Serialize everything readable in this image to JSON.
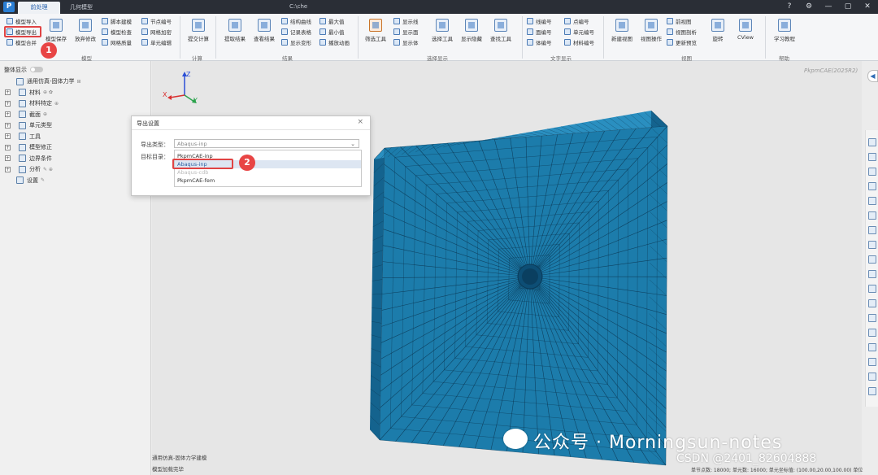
{
  "titlebar": {
    "tabs": [
      "前处理",
      "几何模型"
    ],
    "window_title": "C:\\che",
    "icons": [
      "help-icon",
      "settings-icon",
      "minimize-icon",
      "maximize-icon",
      "close-icon"
    ]
  },
  "ribbon": {
    "model_small": [
      "模型导入",
      "模型导出",
      "模型合并"
    ],
    "model_large": [
      "模型保存",
      "放弃修改"
    ],
    "model_col3": [
      "脚本建模",
      "模型检查",
      "网格质量"
    ],
    "model_col4": [
      "节点编号",
      "网格加密",
      "单元编辑"
    ],
    "calc_button": "提交计算",
    "result_buttons": [
      "提取结果",
      "查看结果"
    ],
    "result_small": [
      "结构曲线",
      "记录表格",
      "显示变形"
    ],
    "result_small2": [
      "最大值",
      "最小值",
      "播放动画"
    ],
    "select_large": "筛选工具",
    "select_small": [
      "显示线",
      "显示面",
      "显示体"
    ],
    "select_buttons": [
      "选择工具",
      "显示隐藏",
      "查找工具"
    ],
    "text_small1": [
      "线编号",
      "面编号",
      "体编号"
    ],
    "text_small2": [
      "点编号",
      "单元编号",
      "材料编号"
    ],
    "view_buttons": [
      "新建视图",
      "视图操作"
    ],
    "view_small": [
      "前视图",
      "视图剖析",
      "更新预览"
    ],
    "view_buttons2": [
      "旋转",
      "CView"
    ],
    "help_button": "学习教程",
    "groups": [
      "模型",
      "计算",
      "结果",
      "选择显示",
      "文字显示",
      "视图",
      "帮助"
    ]
  },
  "left_panel": {
    "title": "整体显示",
    "tree": [
      {
        "label": "通用仿真-固体力学",
        "sub": "⊞",
        "expand": false
      },
      {
        "label": "材料",
        "sub": "⊕ ✿",
        "expand": true
      },
      {
        "label": "材料特定",
        "sub": "⊕",
        "expand": true
      },
      {
        "label": "截面",
        "sub": "⊕",
        "expand": true
      },
      {
        "label": "单元类型",
        "sub": "",
        "expand": true
      },
      {
        "label": "工具",
        "sub": "",
        "expand": true
      },
      {
        "label": "模型修正",
        "sub": "",
        "expand": true
      },
      {
        "label": "边界条件",
        "sub": "",
        "expand": true
      },
      {
        "label": "分析",
        "sub": "✎ ⊕",
        "expand": true
      },
      {
        "label": "设置",
        "sub": "✎",
        "expand": false
      }
    ]
  },
  "status": {
    "line1": "通用仿真-固体力学建模",
    "line2": "模型加载完毕"
  },
  "viewport": {
    "version": "PkpmCAE(2025R2)",
    "axes": {
      "x": "X",
      "y": "Y",
      "z": "Z"
    }
  },
  "dialog": {
    "title": "导出设置",
    "close": "×",
    "label_type": "导出类型：",
    "label_dir": "目标目录：",
    "selected": "Abaqus-inp",
    "options": [
      "PkpmCAE-inp",
      "Abaqus-inp",
      "Abaqus-cdb",
      "PkpmCAE-fem"
    ]
  },
  "annotations": {
    "badge1": "1",
    "badge2": "2"
  },
  "watermark": {
    "text": "公众号 · Morningsun-notes",
    "csdn": "CSDN @2401_82604888"
  },
  "bottom_info": "单节点数: 18000; 单元数: 16000; 单元坐标值: (100.00,20.00,100.00) 单位",
  "colors": {
    "mesh_face": "#1c7cab",
    "mesh_side": "#14638e",
    "mesh_top": "#2a8fc0",
    "highlight": "#e04444"
  }
}
